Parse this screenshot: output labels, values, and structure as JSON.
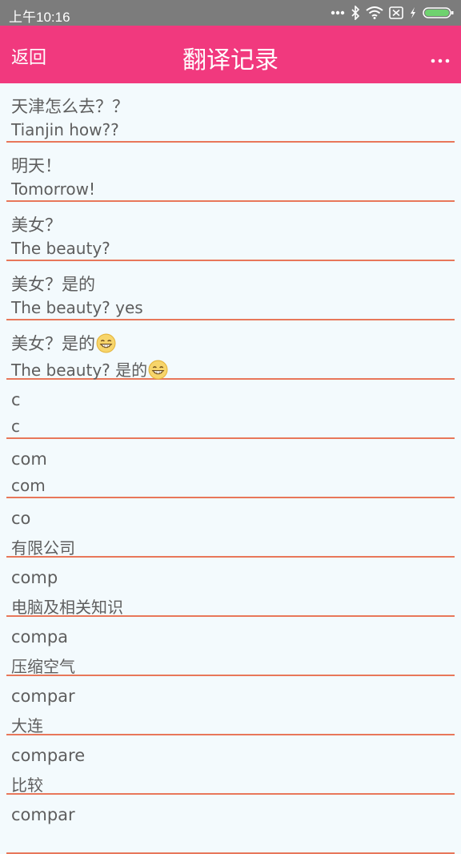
{
  "status_bar": {
    "time": "上午10:16",
    "icons": [
      "more-dots-icon",
      "bluetooth-icon",
      "wifi-icon",
      "sim-x-icon",
      "charging-icon",
      "battery-icon"
    ],
    "battery_color": "#6fd26f"
  },
  "app_bar": {
    "back_label": "返回",
    "title": "翻译记录",
    "more_icon": "more-dots-icon",
    "bg_color": "#f1397e"
  },
  "records": [
    {
      "source": "天津怎么去？？",
      "translation": "Tianjin how??"
    },
    {
      "source": "明天！",
      "translation": "Tomorrow!"
    },
    {
      "source": "美女？",
      "translation": "The beauty?"
    },
    {
      "source": "美女？是的",
      "translation": "The beauty? yes"
    },
    {
      "source": "美女？是的",
      "translation": "The beauty? 是的",
      "emoji": "grinning-face-icon"
    },
    {
      "source": "c",
      "translation": "c"
    },
    {
      "source": "com",
      "translation": "com"
    },
    {
      "source": "co",
      "translation": "有限公司"
    },
    {
      "source": "comp",
      "translation": "电脑及相关知识"
    },
    {
      "source": "compa",
      "translation": "压缩空气"
    },
    {
      "source": "compar",
      "translation": "大连"
    },
    {
      "source": "compare",
      "translation": "比较"
    },
    {
      "source": "compar",
      "translation": ""
    }
  ],
  "divider_color": "#e8775a"
}
